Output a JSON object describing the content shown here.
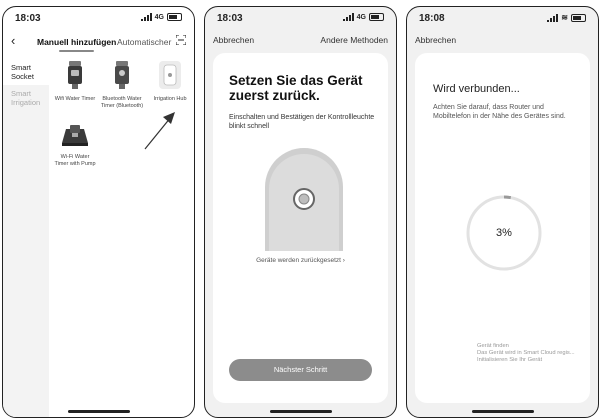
{
  "phone1": {
    "time": "18:03",
    "network": "4G",
    "tabs": {
      "manual": "Manuell hinzufügen",
      "auto": "Automatischer"
    },
    "categories": [
      {
        "label": "Smart Socket"
      },
      {
        "label": "Smart Irrigation"
      }
    ],
    "products": [
      {
        "label": "Wifi Water Timer"
      },
      {
        "label": "Bluetooth Water Timer (Bluetooth)"
      },
      {
        "label": "Irrigation Hub"
      },
      {
        "label": "Wi-Fi Water Timer with Pump"
      }
    ]
  },
  "phone2": {
    "time": "18:03",
    "network": "4G",
    "cancel": "Abbrechen",
    "other_methods": "Andere Methoden",
    "title": "Setzen Sie das Gerät zuerst zurück.",
    "description": "Einschalten und Bestätigen der Kontrollleuchte blinkt schnell",
    "reset_link": "Geräte werden zurückgesetzt ›",
    "next_button": "Nächster Schritt"
  },
  "phone3": {
    "time": "18:08",
    "cancel": "Abbrechen",
    "title": "Wird verbunden...",
    "description": "Achten Sie darauf, dass Router und Mobiltelefon in der Nähe des Gerätes sind.",
    "progress_percent": 3,
    "progress_label": "3%",
    "steps": [
      "Gerät finden",
      "Das Gerät wird in Smart Cloud regis...",
      "Initialisieren Sie Ihr Gerät"
    ]
  }
}
